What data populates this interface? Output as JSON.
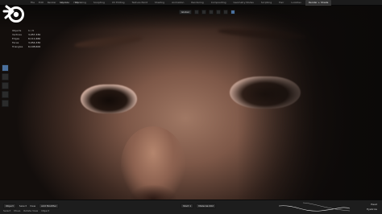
{
  "app": {
    "logo_icon": "blender-logo-icon"
  },
  "menus": [
    "File",
    "Edit",
    "Render",
    "Window",
    "Help"
  ],
  "workspace_tabs": [
    {
      "label": "Layout",
      "active": false
    },
    {
      "label": "Modeling",
      "active": false
    },
    {
      "label": "Sculpting",
      "active": false
    },
    {
      "label": "UV Editing",
      "active": false
    },
    {
      "label": "Texture Paint",
      "active": false
    },
    {
      "label": "Shading",
      "active": false
    },
    {
      "label": "Animation",
      "active": false
    },
    {
      "label": "Rendering",
      "active": false
    },
    {
      "label": "Compositing",
      "active": false
    },
    {
      "label": "Geometry Nodes",
      "active": false
    },
    {
      "label": "Scripting",
      "active": false
    },
    {
      "label": "Hair",
      "active": false
    },
    {
      "label": "Lookdev",
      "active": false
    },
    {
      "label": "Render + Shade",
      "active": true
    }
  ],
  "viewport_header": {
    "shading": "Global",
    "overlay_icon": "overlay-icon",
    "gizmo_icon": "gizmo-icon"
  },
  "stats": [
    {
      "key": "Objects",
      "value": "1 / 3"
    },
    {
      "key": "Vertices",
      "value": "3,057,330"
    },
    {
      "key": "Edges",
      "value": "6,111,660"
    },
    {
      "key": "Faces",
      "value": "3,054,330"
    },
    {
      "key": "Triangles",
      "value": "6,108,600"
    }
  ],
  "statusbar": {
    "mode": "Object",
    "select": "Select",
    "view": "View",
    "item": "Add Modifier",
    "frame": "Start 1",
    "material": "Material.002",
    "row2": [
      "Select",
      "Move",
      "Rotate View",
      "Object"
    ]
  },
  "curve_labels": [
    "Head",
    "Eyebrow"
  ],
  "colors": {
    "accent": "#4a6f9c",
    "header": "#1b1b1b",
    "skin": "#a07864"
  }
}
